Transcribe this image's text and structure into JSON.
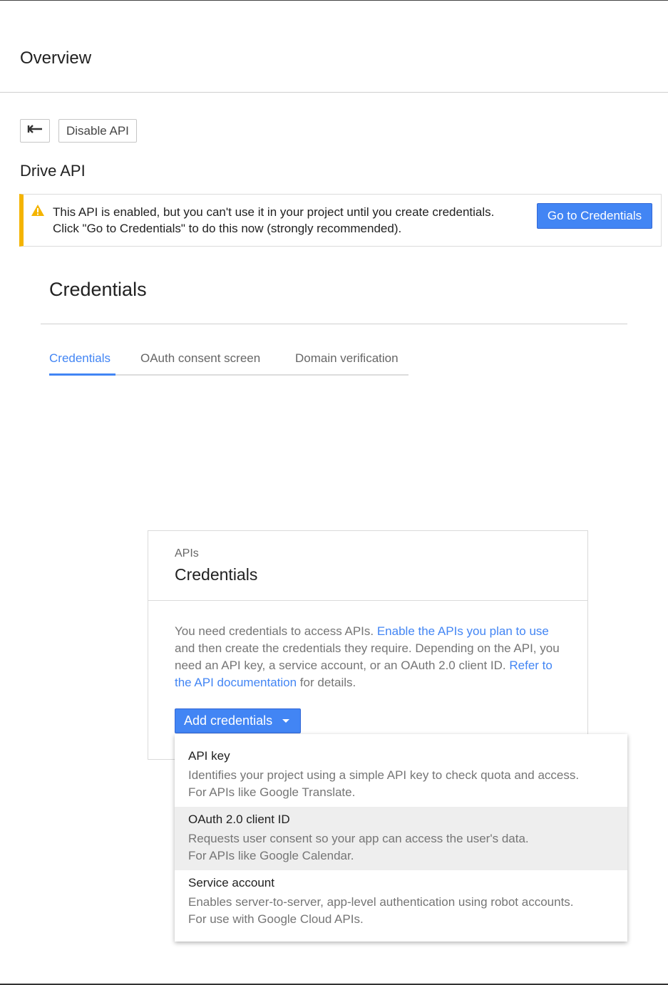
{
  "header": {
    "title": "Overview"
  },
  "toolbar": {
    "disable_label": "Disable API"
  },
  "api": {
    "name": "Drive API"
  },
  "warning": {
    "line1": "This API is enabled, but you can't use it in your project until you create credentials.",
    "line2": "Click \"Go to Credentials\" to do this now (strongly recommended).",
    "button_label": "Go to Credentials"
  },
  "credentials_section": {
    "heading": "Credentials",
    "tabs": [
      {
        "label": "Credentials"
      },
      {
        "label": "OAuth consent screen"
      },
      {
        "label": "Domain verification"
      }
    ]
  },
  "card": {
    "subtitle": "APIs",
    "title": "Credentials",
    "body_1": "You need credentials to access APIs.",
    "link_1": "Enable the APIs you plan to use",
    "body_2": "and then create the credentials they require. Depending on the API, you need an API key, a service account, or an OAuth 2.0 client ID.",
    "link_2": "Refer to the API documentation",
    "body_3": "for details.",
    "add_button_label": "Add credentials"
  },
  "menu": {
    "items": [
      {
        "title": "API key",
        "desc1": "Identifies your project using a simple API key to check quota and access.",
        "desc2": "For APIs like Google Translate."
      },
      {
        "title": "OAuth 2.0 client ID",
        "desc1": "Requests user consent so your app can access the user's data.",
        "desc2": "For APIs like Google Calendar."
      },
      {
        "title": "Service account",
        "desc1": "Enables server-to-server, app-level authentication using robot accounts.",
        "desc2": "For use with Google Cloud APIs."
      }
    ]
  },
  "colors": {
    "accent": "#4285f4",
    "warning": "#f4b400",
    "highlight": "#eeeeee"
  }
}
